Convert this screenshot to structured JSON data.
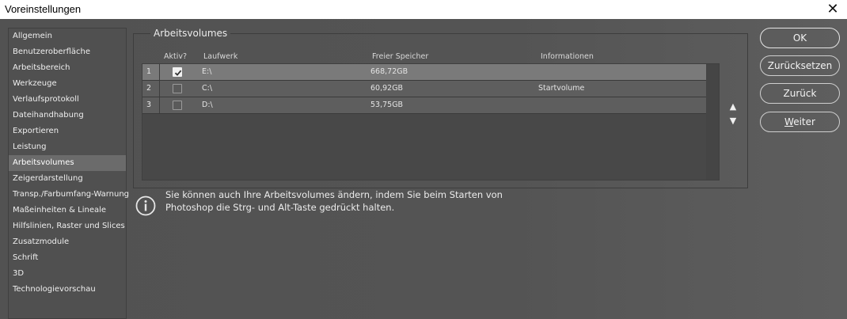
{
  "window": {
    "title": "Voreinstellungen",
    "close_glyph": "✕"
  },
  "sidebar": {
    "items": [
      {
        "label": "Allgemein"
      },
      {
        "label": "Benutzeroberfläche"
      },
      {
        "label": "Arbeitsbereich"
      },
      {
        "label": "Werkzeuge"
      },
      {
        "label": "Verlaufsprotokoll"
      },
      {
        "label": "Dateihandhabung"
      },
      {
        "label": "Exportieren"
      },
      {
        "label": "Leistung"
      },
      {
        "label": "Arbeitsvolumes",
        "active": true
      },
      {
        "label": "Zeigerdarstellung"
      },
      {
        "label": "Transp./Farbumfang-Warnung"
      },
      {
        "label": "Maßeinheiten & Lineale"
      },
      {
        "label": "Hilfslinien, Raster und Slices"
      },
      {
        "label": "Zusatzmodule"
      },
      {
        "label": "Schrift"
      },
      {
        "label": "3D"
      },
      {
        "label": "Technologievorschau"
      }
    ]
  },
  "scratch": {
    "group_title": "Arbeitsvolumes",
    "columns": {
      "active": "Aktiv?",
      "drive": "Laufwerk",
      "free": "Freier Speicher",
      "info": "Informationen"
    },
    "rows": [
      {
        "num": "1",
        "active": true,
        "drive": "E:\\",
        "free": "668,72GB",
        "info": ""
      },
      {
        "num": "2",
        "active": false,
        "drive": "C:\\",
        "free": "60,92GB",
        "info": "Startvolume"
      },
      {
        "num": "3",
        "active": false,
        "drive": "D:\\",
        "free": "53,75GB",
        "info": ""
      }
    ],
    "move_up_glyph": "▲",
    "move_down_glyph": "▼",
    "info_line1": "Sie können auch Ihre Arbeitsvolumes ändern, indem Sie beim Starten von",
    "info_line2": "Photoshop die Strg- und Alt-Taste gedrückt halten."
  },
  "buttons": {
    "ok": "OK",
    "reset": "Zurücksetzen",
    "back": "Zurück",
    "next_first": "W",
    "next_rest": "eiter"
  },
  "colors": {
    "background": "#535353",
    "selected_row": "#7a7a7a",
    "active_sidebar": "#6b6b6b"
  }
}
